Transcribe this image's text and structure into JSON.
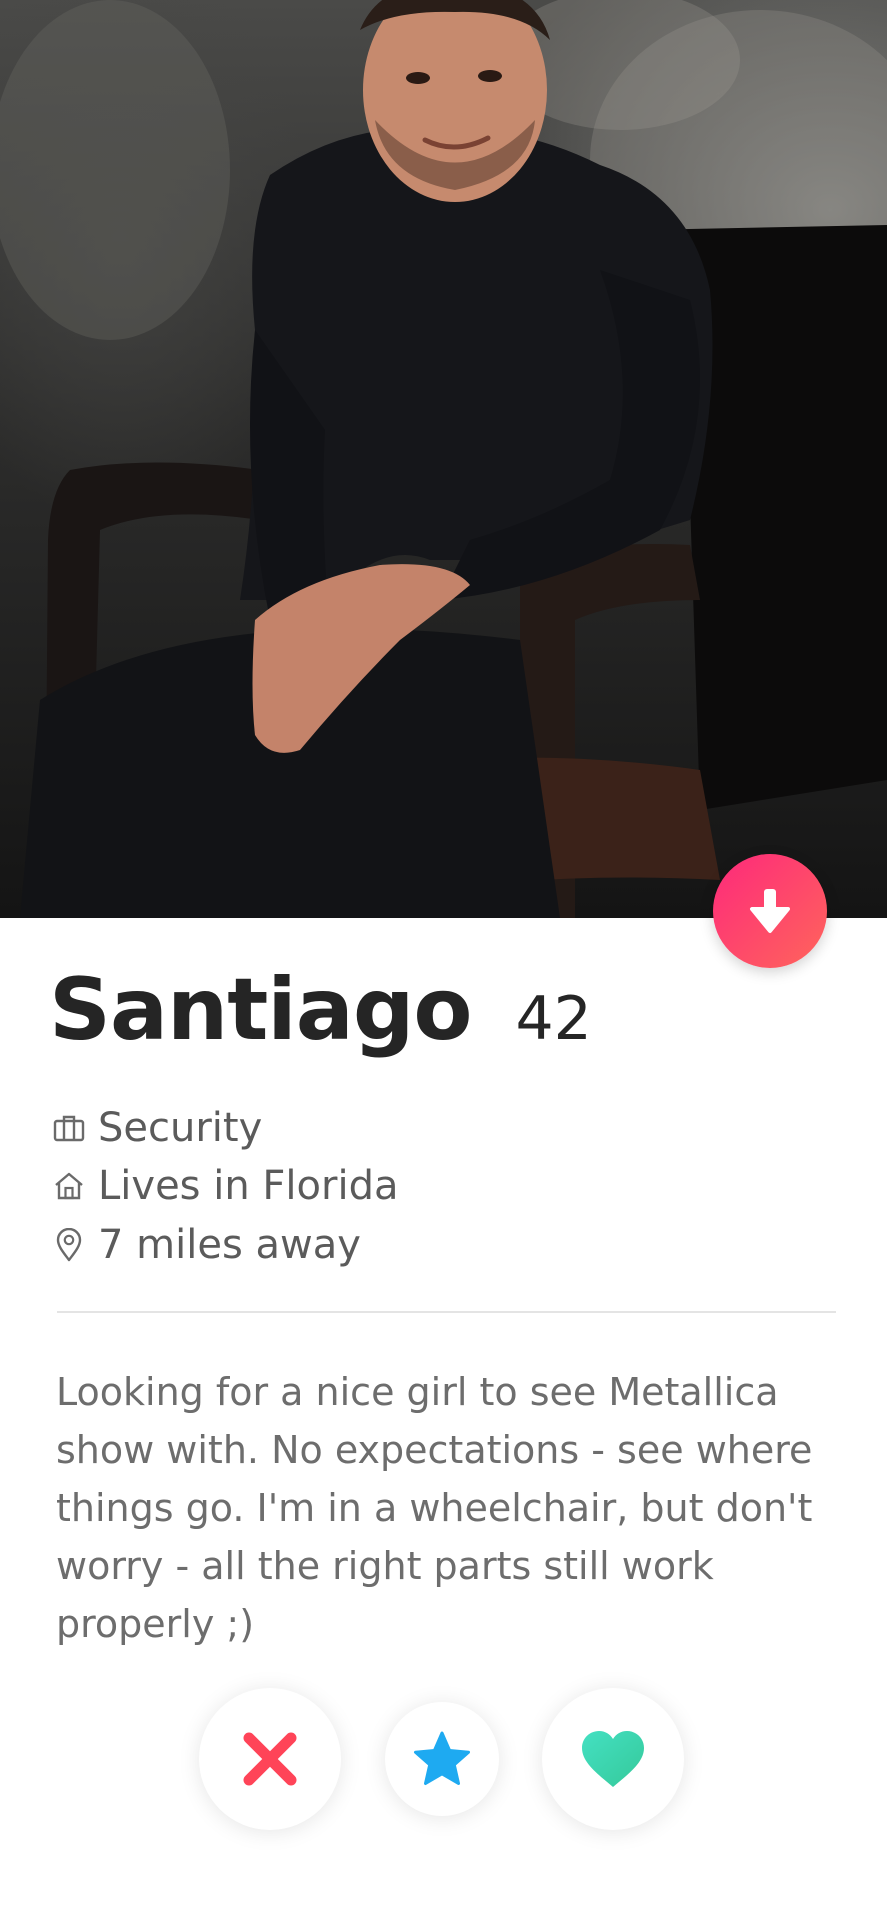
{
  "profile": {
    "name": "Santiago",
    "age": "42",
    "job": "Security",
    "location": "Lives in Florida",
    "distance": "7 miles away",
    "bio": "Looking for a nice girl to see Metallica show with. No expectations - see where things go. I'm in a wheelchair, but don't worry - all the right parts still work properly ;)"
  },
  "icons": {
    "job": "briefcase-icon",
    "location": "home-icon",
    "distance": "map-pin-icon",
    "collapse": "arrow-down-icon",
    "nope": "x-icon",
    "superlike": "star-icon",
    "like": "heart-icon"
  },
  "colors": {
    "brand_gradient_start": "#fd297b",
    "brand_gradient_end": "#ff655b",
    "nope": "#ff4458",
    "superlike": "#1eaaf1",
    "like": "#3ed7b0",
    "name_text": "#252525",
    "info_text": "#5b5b5b",
    "bio_text": "#6d6d6d"
  }
}
